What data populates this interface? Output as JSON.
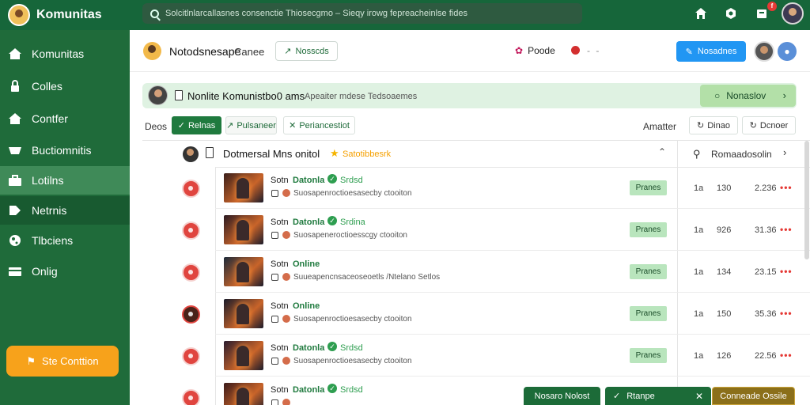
{
  "app": {
    "brand_name": "Komunitas",
    "search_placeholder": "Solcitlnlarcallasnes consenctie Thiosecgmo – Sieqy irowg fepreacheinlse fides",
    "notification_count": "f"
  },
  "sidebar": {
    "items": [
      {
        "label": "Komunitas",
        "icon": "home-icon"
      },
      {
        "label": "Colles",
        "icon": "lock-icon"
      },
      {
        "label": "Contfer",
        "icon": "home-icon"
      },
      {
        "label": "Buctiomnitis",
        "icon": "basket-icon"
      },
      {
        "label": "Lotilns",
        "icon": "briefcase-icon"
      },
      {
        "label": "Netrnis",
        "icon": "tag-icon"
      },
      {
        "label": "Tlbciens",
        "icon": "globe-icon"
      },
      {
        "label": "Onlig",
        "icon": "card-icon"
      }
    ],
    "cta_label": "Ste Conttion"
  },
  "header": {
    "title": "Notodsnesape",
    "subtitle": "Canee",
    "outline_button": "Nosscds",
    "people_label": "Poode",
    "primary_button": "Nosadnes"
  },
  "banner": {
    "title": "Nonlite Komunistbo0 ams",
    "subtitle": "Apeaiter mdese Tedsoaemes",
    "button_label": "Nonaslov"
  },
  "filters": {
    "label": "Deos",
    "tab_active": "Relnas",
    "tab_2": "Pulsaneer",
    "tab_3": "Periancestiot",
    "sort_label": "Amatter",
    "select_1": "Dinao",
    "select_2": "Dcnoer"
  },
  "list_header": {
    "title": "Dotmersal Mns onitol",
    "star_label": "Satotibbesrk",
    "right_label": "Romaadosolin"
  },
  "rows": [
    {
      "name": "Sotn",
      "status": "Datonla",
      "verified": true,
      "tag": "Srdsd",
      "desc": "Suosapenroctioesasecby ctooiton",
      "pill": "Pranes",
      "c1": "1a",
      "c2": "130",
      "c3": "2.236",
      "avatar_dark": false,
      "thumb": "#3a1f1a"
    },
    {
      "name": "Sotn",
      "status": "Datonla",
      "verified": true,
      "tag": "Srdina",
      "desc": "Suosapeneroctioesscgy ctooiton",
      "pill": "Pranes",
      "c1": "1a",
      "c2": "926",
      "c3": "31.36",
      "avatar_dark": false,
      "thumb": "#2a1a22"
    },
    {
      "name": "Sotn",
      "status": "Online",
      "verified": false,
      "tag": "",
      "desc": "Suueapencnsaceoseoetls /Ntelano Setlos",
      "pill": "Pranes",
      "c1": "1a",
      "c2": "134",
      "c3": "23.15",
      "avatar_dark": false,
      "thumb": "#1c2a3a"
    },
    {
      "name": "Sotn",
      "status": "Online",
      "verified": false,
      "tag": "",
      "desc": "Suosapenroctioesasecby ctooiton",
      "pill": "Pranes",
      "c1": "1a",
      "c2": "150",
      "c3": "35.36",
      "avatar_dark": true,
      "thumb": "#1a1c2a"
    },
    {
      "name": "Sotn",
      "status": "Datonla",
      "verified": true,
      "tag": "Srdsd",
      "desc": "Suosapenroctioesasecby ctooiton",
      "pill": "Pranes",
      "c1": "1a",
      "c2": "126",
      "c3": "22.56",
      "avatar_dark": false,
      "thumb": "#2a1c2e"
    },
    {
      "name": "Sotn",
      "status": "Datonla",
      "verified": true,
      "tag": "Srdsd",
      "desc": "",
      "pill": "",
      "c1": "",
      "c2": "",
      "c3": "",
      "avatar_dark": false,
      "thumb": "#3a1a1a"
    }
  ],
  "bottom_bar": {
    "btn_1": "Nosaro Nolost",
    "btn_2": "Rtanpe",
    "btn_3": "Conneade Ossile"
  },
  "colors": {
    "brand_green": "#1f6b3a",
    "accent_orange": "#f7a21b",
    "primary_blue": "#2196f3",
    "status_green": "#2e9e50",
    "danger_red": "#e53935"
  }
}
